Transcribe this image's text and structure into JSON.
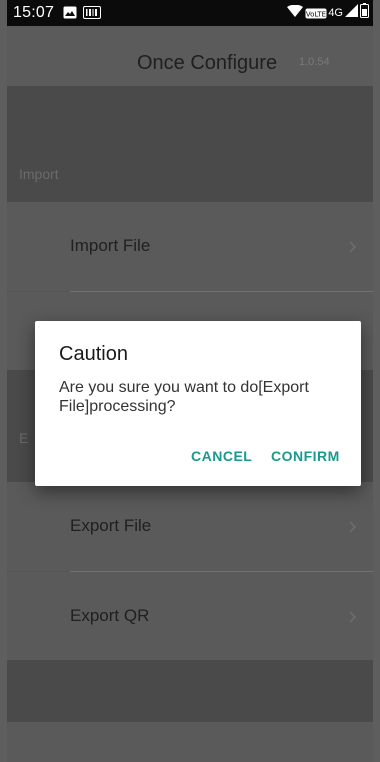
{
  "status_bar": {
    "time": "15:07",
    "network_label": "VoLTE 4G"
  },
  "app_bar": {
    "title": "Once Configure",
    "version": "1.0.54"
  },
  "sections": {
    "import_header": "Import",
    "export_header": "E",
    "import_items": [
      {
        "label": "Import File"
      }
    ],
    "export_items": [
      {
        "label": "Export File"
      },
      {
        "label": "Export QR"
      }
    ]
  },
  "dialog": {
    "title": "Caution",
    "message": "Are you sure you want to do[Export File]processing?",
    "cancel_label": "CANCEL",
    "confirm_label": "CONFIRM"
  },
  "colors": {
    "accent": "#1a9a8e",
    "scrim_background": "#565656",
    "dialog_background": "#ffffff"
  }
}
